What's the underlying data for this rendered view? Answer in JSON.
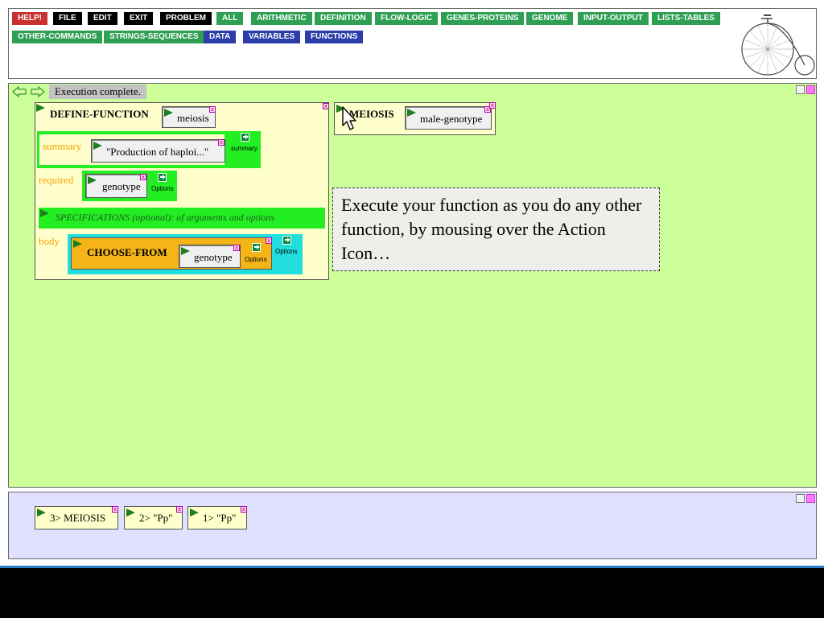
{
  "menu": {
    "row1": [
      {
        "label": "HELP!",
        "color": "#c8312f"
      },
      {
        "label": "FILE",
        "color": "#000000"
      },
      {
        "label": "EDIT",
        "color": "#000000"
      },
      {
        "label": "EXIT",
        "color": "#000000"
      },
      {
        "label": "PROBLEM",
        "color": "#000000"
      },
      {
        "label": "ALL",
        "color": "#2f9f54"
      },
      {
        "label": "ARITHMETIC",
        "color": "#2f9f54"
      },
      {
        "label": "DEFINITION",
        "color": "#2f9f54"
      },
      {
        "label": "FLOW-LOGIC",
        "color": "#2f9f54"
      },
      {
        "label": "GENES-PROTEINS",
        "color": "#2f9f54"
      },
      {
        "label": "GENOME",
        "color": "#2f9f54"
      },
      {
        "label": "INPUT-OUTPUT",
        "color": "#2f9f54"
      },
      {
        "label": "LISTS-TABLES",
        "color": "#2f9f54"
      }
    ],
    "row2": [
      {
        "label": "OTHER-COMMANDS",
        "color": "#2f9f54"
      },
      {
        "label": "STRINGS-SEQUENCES",
        "color": "#2f9f54"
      },
      {
        "label": "DATA",
        "color": "#2a3da8"
      },
      {
        "label": "VARIABLES",
        "color": "#2a3da8"
      },
      {
        "label": "FUNCTIONS",
        "color": "#2a3da8"
      }
    ]
  },
  "workspace": {
    "status": "Execution complete.",
    "define_function": {
      "keyword": "DEFINE-FUNCTION",
      "name": "meiosis",
      "summary_label": "summary",
      "summary_value": "\"Production of haploi...\"",
      "summary_option": "summary",
      "required_label": "required",
      "required_value": "genotype",
      "required_option": "Options",
      "specifications": "SPECIFICATIONS (optional): of arguments and options",
      "body_label": "body",
      "body_keyword": "CHOOSE-FROM",
      "body_value": "genotype",
      "body_option_inner": "Options",
      "body_option_outer": "Options"
    },
    "call_box": {
      "keyword": "MEIOSIS",
      "arg": "male-genotype"
    },
    "note": "Execute your function as you do any other function, by mousing over the Action Icon…"
  },
  "history": [
    {
      "label": "3> MEIOSIS"
    },
    {
      "label": "2> \"Pp\""
    },
    {
      "label": "1> \"Pp\""
    }
  ]
}
